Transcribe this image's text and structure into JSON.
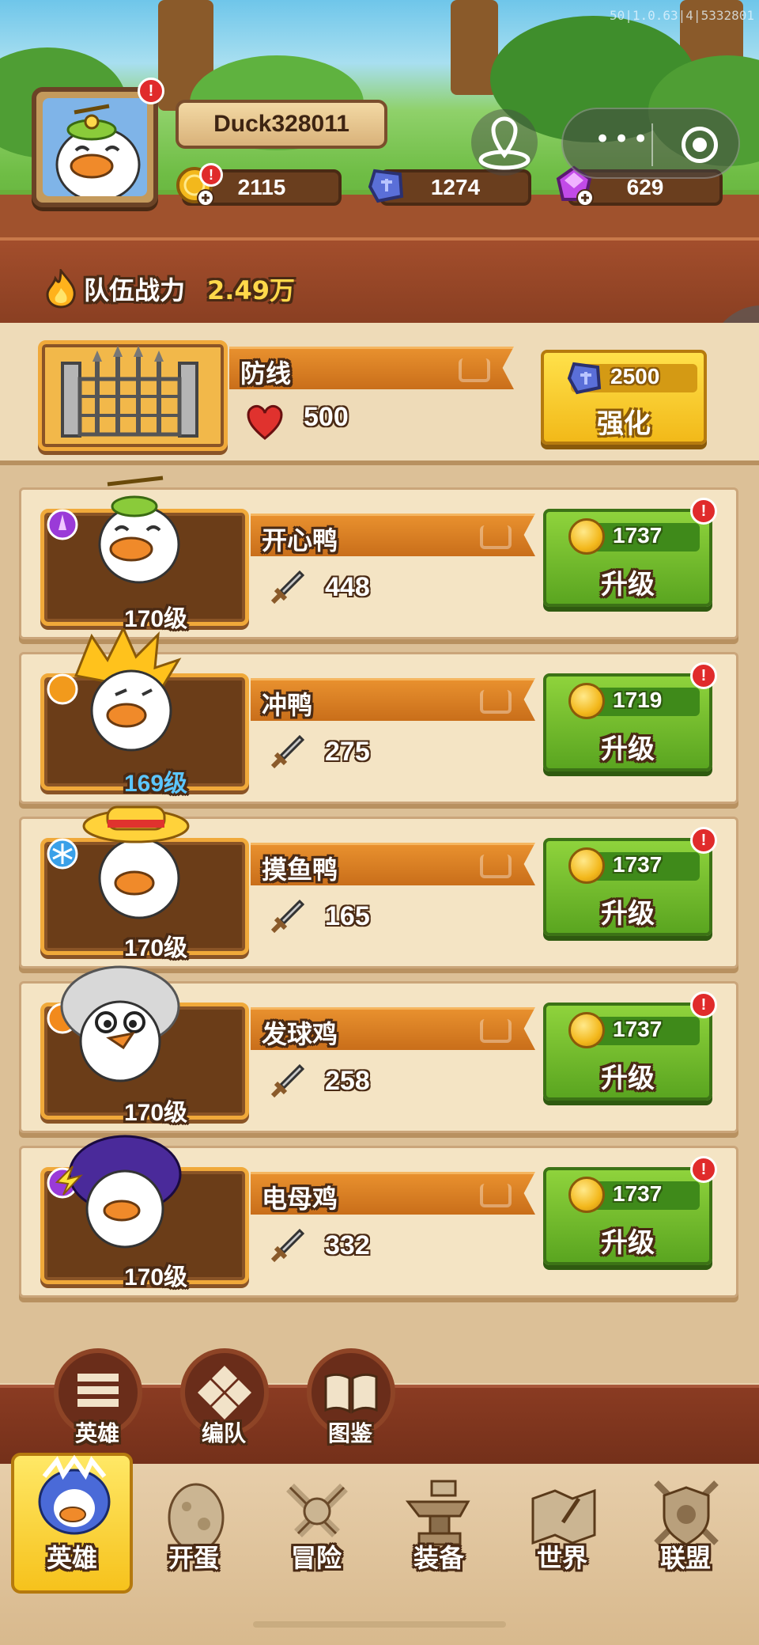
{
  "build_version": "50|1.0.63|4|5332801",
  "player": {
    "name": "Duck328011"
  },
  "resources": {
    "gold": "2115",
    "stone": "1274",
    "gem": "629"
  },
  "team_power": {
    "label": "队伍战力",
    "value": "2.49万"
  },
  "defense": {
    "name": "防线",
    "hp": "500",
    "reinforce_cost": "2500",
    "reinforce_label": "强化"
  },
  "heroes": [
    {
      "name": "开心鸭",
      "attack": "448",
      "level": "170级",
      "cost": "1737",
      "action": "升级"
    },
    {
      "name": "冲鸭",
      "attack": "275",
      "level": "169级",
      "cost": "1719",
      "action": "升级"
    },
    {
      "name": "摸鱼鸭",
      "attack": "165",
      "level": "170级",
      "cost": "1737",
      "action": "升级"
    },
    {
      "name": "发球鸡",
      "attack": "258",
      "level": "170级",
      "cost": "1737",
      "action": "升级"
    },
    {
      "name": "电母鸡",
      "attack": "332",
      "level": "170级",
      "cost": "1737",
      "action": "升级"
    }
  ],
  "subnav": [
    {
      "label": "英雄",
      "icon": "list-icon"
    },
    {
      "label": "编队",
      "icon": "formation-icon"
    },
    {
      "label": "图鉴",
      "icon": "book-icon"
    }
  ],
  "tabs": [
    {
      "label": "英雄",
      "icon": "hero-icon",
      "active": true
    },
    {
      "label": "开蛋",
      "icon": "egg-icon"
    },
    {
      "label": "冒险",
      "icon": "crossed-swords-icon"
    },
    {
      "label": "装备",
      "icon": "anvil-icon"
    },
    {
      "label": "世界",
      "icon": "map-icon"
    },
    {
      "label": "联盟",
      "icon": "shield-icon"
    }
  ],
  "colors": {
    "upgrade_green": "#6cbd2a",
    "reinforce_yellow": "#f6c21c",
    "banner_orange": "#e08226",
    "alert_red": "#e02b2b"
  }
}
